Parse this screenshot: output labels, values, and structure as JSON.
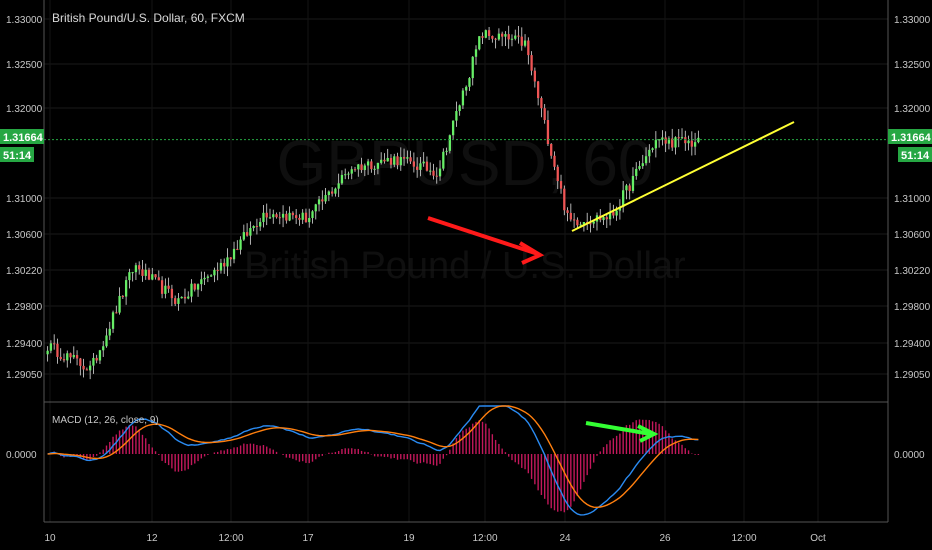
{
  "header": {
    "symbol_title": "British Pound/U.S. Dollar, 60, FXCM"
  },
  "watermark": {
    "ticker": "GBPUSD, 60",
    "description": "British Pound / U.S. Dollar"
  },
  "price_axis": {
    "labels": [
      "1.33000",
      "1.32500",
      "1.32000",
      "1.31000",
      "1.30600",
      "1.30220",
      "1.29800",
      "1.29400",
      "1.29050"
    ],
    "current_price": "1.31664",
    "countdown": "51:14",
    "tag_color": "#26a743"
  },
  "macd": {
    "label": "MACD (12, 26, close, 9)",
    "zero_label": "0.0000",
    "macd_color": "#2a8bf2",
    "signal_color": "#ff7f0e",
    "hist_color": "#c2185b"
  },
  "time_axis": {
    "labels": [
      "10",
      "12",
      "12:00",
      "17",
      "19",
      "12:00",
      "24",
      "26",
      "12:00",
      "Oct"
    ]
  },
  "annotations": {
    "trendline_color": "#ffff33",
    "red_arrow_color": "#ff1a1a",
    "green_arrow_color": "#33ff33"
  },
  "chart_data": {
    "type": "candlestick",
    "ylim": [
      1.2883,
      1.3312
    ],
    "current_price": 1.31664,
    "key_closes": [
      {
        "at": "10",
        "price": 1.2935
      },
      {
        "at": "10",
        "price": 1.2908
      },
      {
        "at": "10",
        "price": 1.3025
      },
      {
        "at": "12",
        "price": 1.2985
      },
      {
        "at": "12",
        "price": 1.3025
      },
      {
        "at": "12:00",
        "price": 1.3085
      },
      {
        "at": "17",
        "price": 1.3078
      },
      {
        "at": "17",
        "price": 1.3135
      },
      {
        "at": "19",
        "price": 1.3145
      },
      {
        "at": "19",
        "price": 1.313
      },
      {
        "at": "12:00",
        "price": 1.3285
      },
      {
        "at": "12:00",
        "price": 1.3275
      },
      {
        "at": "24",
        "price": 1.3075
      },
      {
        "at": "24",
        "price": 1.308
      },
      {
        "at": "26",
        "price": 1.3165
      },
      {
        "at": "26",
        "price": 1.3163
      }
    ]
  }
}
